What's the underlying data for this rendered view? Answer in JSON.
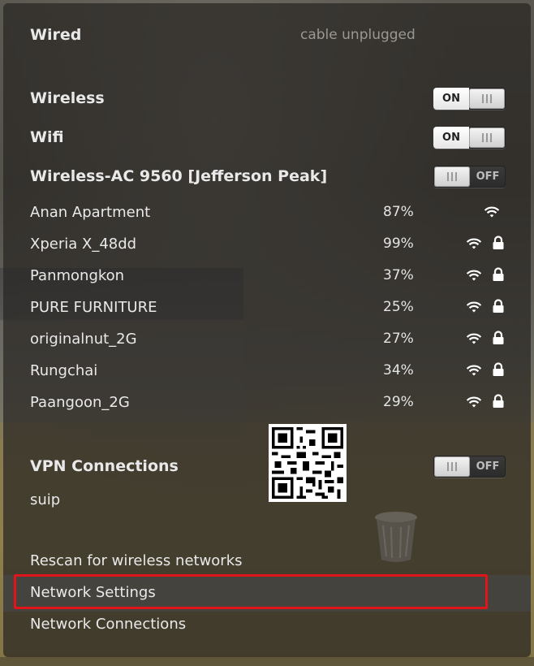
{
  "wired": {
    "label": "Wired",
    "status": "cable unplugged"
  },
  "wireless": {
    "label": "Wireless",
    "toggle": "ON"
  },
  "wifi": {
    "label": "Wifi",
    "toggle": "ON"
  },
  "adapter": {
    "label": "Wireless-AC 9560 [Jefferson Peak]",
    "toggle": "OFF"
  },
  "networks": [
    {
      "name": "Anan Apartment",
      "strength": "87%",
      "locked": false
    },
    {
      "name": "Xperia X_48dd",
      "strength": "99%",
      "locked": true
    },
    {
      "name": "Panmongkon",
      "strength": "37%",
      "locked": true
    },
    {
      "name": "PURE FURNITURE",
      "strength": "25%",
      "locked": true
    },
    {
      "name": "originalnut_2G",
      "strength": "27%",
      "locked": true
    },
    {
      "name": "Rungchai",
      "strength": "34%",
      "locked": true
    },
    {
      "name": "Paangoon_2G",
      "strength": "29%",
      "locked": true
    }
  ],
  "vpn": {
    "label": "VPN Connections",
    "toggle": "OFF",
    "connections": [
      "suip"
    ]
  },
  "actions": {
    "rescan": "Rescan for wireless networks",
    "settings": "Network Settings",
    "connections": "Network Connections"
  },
  "icons": {
    "signal": "wifi-signal-icon",
    "lock": "lock-icon"
  },
  "colors": {
    "highlight": "#e0141a",
    "panel": "#2a2825"
  }
}
